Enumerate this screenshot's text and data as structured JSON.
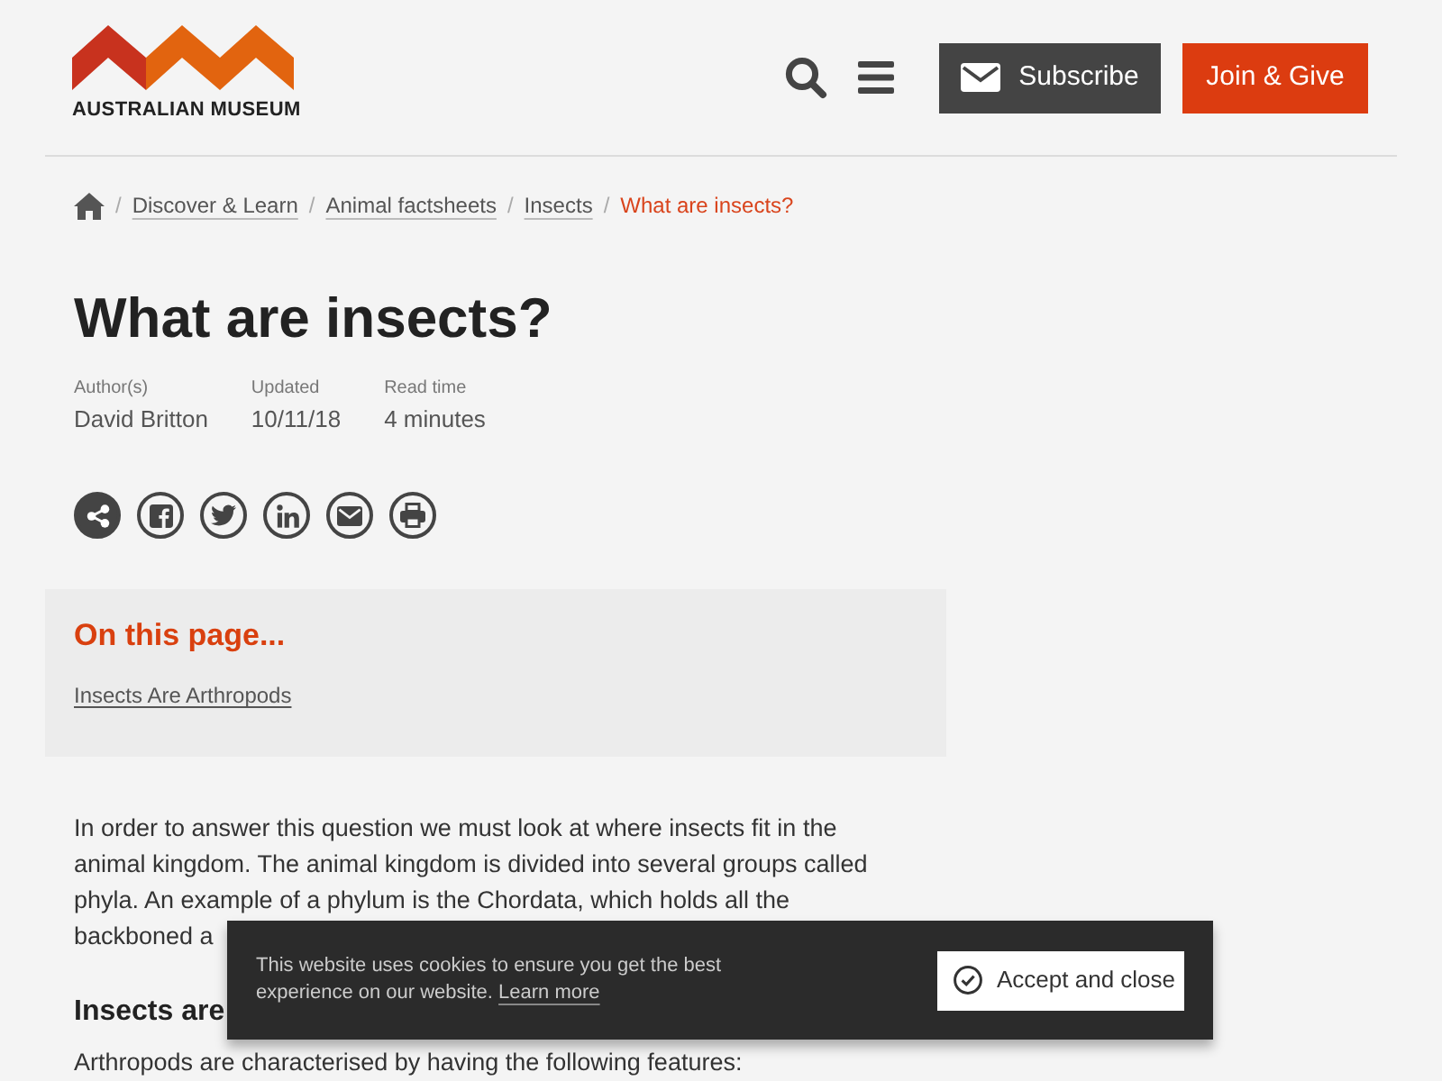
{
  "header": {
    "logo_text": "AUSTRALIAN MUSEUM",
    "actions": [
      {
        "kind": "search"
      },
      {
        "kind": "menu"
      }
    ],
    "buttons": [
      {
        "kind": "subscribe",
        "label": "Subscribe"
      },
      {
        "kind": "join",
        "label": "Join & Give"
      }
    ]
  },
  "breadcrumbs": [
    {
      "kind": "home"
    },
    {
      "kind": "link",
      "separator": "/",
      "label": "Discover & Learn",
      "current": false
    },
    {
      "kind": "link",
      "separator": "/",
      "label": "Animal factsheets",
      "current": false
    },
    {
      "kind": "link",
      "separator": "/",
      "label": "Insects",
      "current": false
    },
    {
      "kind": "link",
      "separator": "/",
      "label": "What are insects?",
      "current": true
    }
  ],
  "article": {
    "title": "What are insects?",
    "meta": [
      {
        "label": "Author(s)",
        "value": "David Britton"
      },
      {
        "label": "Updated",
        "value": "10/11/18"
      },
      {
        "label": "Read time",
        "value": "4 minutes"
      }
    ],
    "share_buttons": [
      {
        "kind": "share"
      },
      {
        "kind": "facebook"
      },
      {
        "kind": "twitter"
      },
      {
        "kind": "linkedin"
      },
      {
        "kind": "email"
      },
      {
        "kind": "print"
      }
    ],
    "on_this_page": {
      "heading": "On this page...",
      "links": [
        "Insects Are Arthropods"
      ]
    },
    "content": [
      {
        "kind": "paragraph",
        "text": "In order to answer this question we must look at where insects fit in the animal kingdom. The animal kingdom is divided into several groups called phyla. An example of a phylum is the Chordata, which holds all the backboned a"
      },
      {
        "kind": "heading",
        "text": "Insects are"
      },
      {
        "kind": "paragraph",
        "text": "Arthropods are characterised by having the following features:"
      }
    ]
  },
  "cookie_banner": {
    "message": "This website uses cookies to ensure you get the best experience on our website.",
    "link": "Learn more",
    "button": "Accept and close"
  }
}
